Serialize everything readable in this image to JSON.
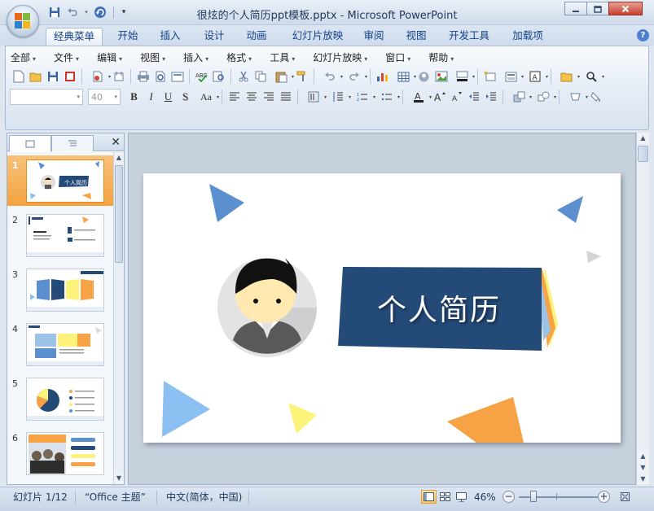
{
  "window": {
    "title": "很炫的个人简历ppt模板.pptx - Microsoft PowerPoint"
  },
  "quick_access": [
    "save-icon",
    "undo-icon",
    "redo-icon",
    "customize-qat-icon"
  ],
  "tabs": [
    {
      "label": "经典菜单",
      "active": true
    },
    {
      "label": "开始"
    },
    {
      "label": "插入"
    },
    {
      "label": "设计"
    },
    {
      "label": "动画"
    },
    {
      "label": "幻灯片放映"
    },
    {
      "label": "审阅"
    },
    {
      "label": "视图"
    },
    {
      "label": "开发工具"
    },
    {
      "label": "加载项"
    }
  ],
  "classic_menu": [
    "全部",
    "文件",
    "编辑",
    "视图",
    "插入",
    "格式",
    "工具",
    "幻灯片放映",
    "窗口",
    "帮助"
  ],
  "formatting": {
    "font_name": "",
    "font_size": "40",
    "bold": "B",
    "italic": "I",
    "underline": "U",
    "strike": "S",
    "case": "Aa"
  },
  "slides_panel": {
    "slides": [
      {
        "num": "1",
        "selected": true
      },
      {
        "num": "2"
      },
      {
        "num": "3"
      },
      {
        "num": "4"
      },
      {
        "num": "5"
      },
      {
        "num": "6"
      }
    ]
  },
  "current_slide": {
    "title": "个人简历"
  },
  "statusbar": {
    "slide_info": "幻灯片 1/12",
    "theme": "“Office 主题”",
    "language": "中文(简体，中国)",
    "zoom": "46%"
  },
  "colors": {
    "accent_blue": "#5b8fd0",
    "title_box": "#244a78",
    "orange": "#f7a245",
    "yellow": "#fdf37b",
    "selection": "#f3a23e"
  }
}
